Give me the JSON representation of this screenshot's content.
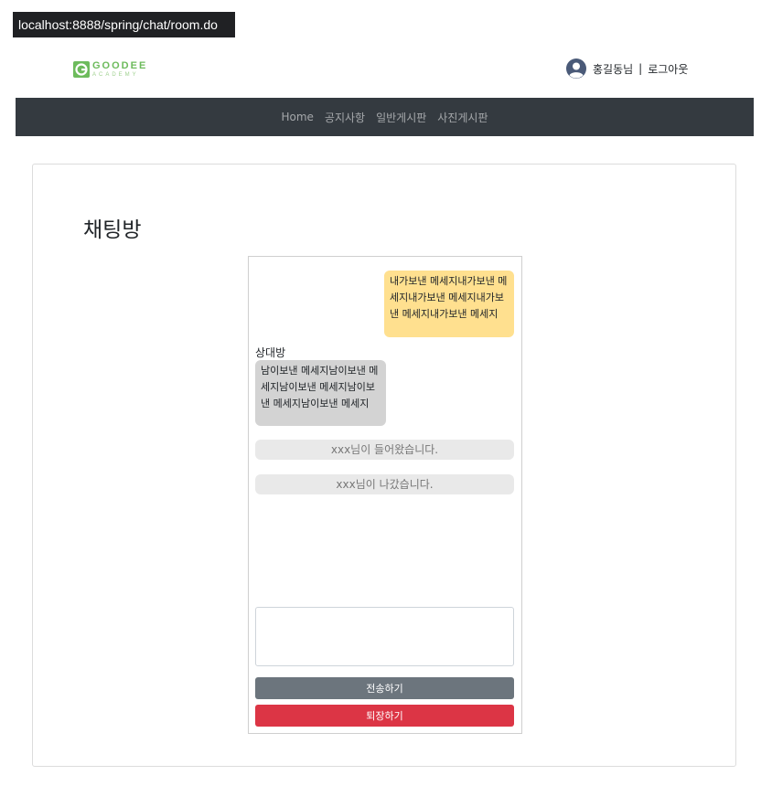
{
  "browser": {
    "url": "localhost:8888/spring/chat/room.do"
  },
  "header": {
    "logo_name": "GOODEE",
    "logo_sub": "ACADEMY",
    "user_name": "홍길동님",
    "separator": "|",
    "logout_label": "로그아웃"
  },
  "nav": {
    "items": [
      {
        "label": "Home"
      },
      {
        "label": "공지사항"
      },
      {
        "label": "일반게시판"
      },
      {
        "label": "사진게시판"
      }
    ]
  },
  "page": {
    "title": "채팅방"
  },
  "chat": {
    "messages": {
      "mine": "내가보낸 메세지내가보낸 메세지내가보낸 메세지내가보낸 메세지내가보낸 메세지",
      "other_sender": "상대방",
      "other": "남이보낸 메세지남이보낸 메세지남이보낸 메세지남이보낸 메세지남이보낸 메세지"
    },
    "notices": {
      "entered": "xxx님이 들어왔습니다.",
      "left": "xxx님이 나갔습니다."
    },
    "input_value": "",
    "send_label": "전송하기",
    "leave_label": "퇴장하기"
  },
  "colors": {
    "navbar": "#343a40",
    "my_bubble": "#ffe08f",
    "other_bubble": "#d3d3d3",
    "notice": "#e9e9e9",
    "send_button": "#6c757d",
    "leave_button": "#dc3545",
    "logo_accent": "#6dbb5c"
  }
}
